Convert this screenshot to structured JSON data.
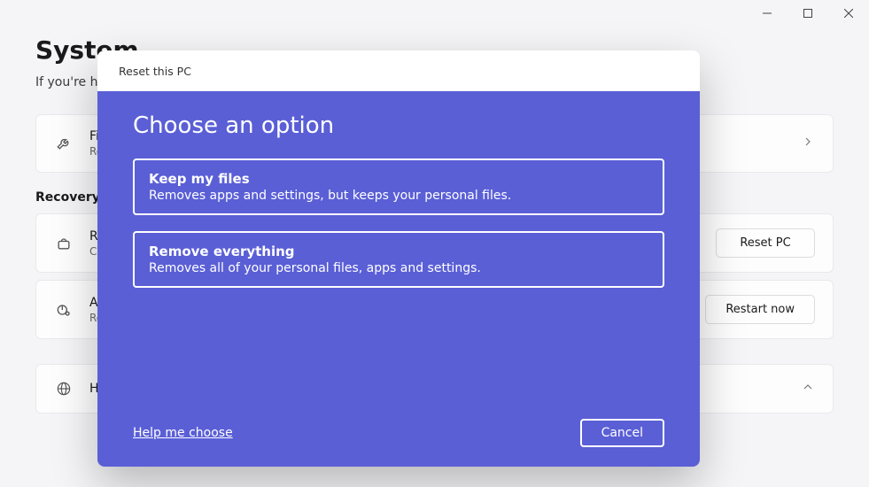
{
  "window": {
    "minimize": "–",
    "maximize": "▢",
    "close": "✕"
  },
  "page": {
    "title": "System",
    "subtitle": "If you're having problems with your PC or want to reset it, these recovery options might help."
  },
  "card_fix": {
    "title": "Fix problems without resetting your PC",
    "subtitle": "Resetting can take a while—first, try resolving issues by running a troubleshooter"
  },
  "section_recovery": "Recovery options",
  "card_reset": {
    "title": "Reset this PC",
    "subtitle": "Choose to keep or remove your personal files, then reinstall Windows",
    "button": "Reset PC"
  },
  "card_advanced": {
    "title": "Advanced startup",
    "subtitle": "Restart your device to change startup settings, including starting from a disc or USB drive",
    "button": "Restart now"
  },
  "card_help": {
    "title": "Help with Recovery"
  },
  "modal": {
    "header": "Reset this PC",
    "title": "Choose an option",
    "options": [
      {
        "title": "Keep my files",
        "desc": "Removes apps and settings, but keeps your personal files."
      },
      {
        "title": "Remove everything",
        "desc": "Removes all of your personal files, apps and settings."
      }
    ],
    "help": "Help me choose",
    "cancel": "Cancel"
  }
}
